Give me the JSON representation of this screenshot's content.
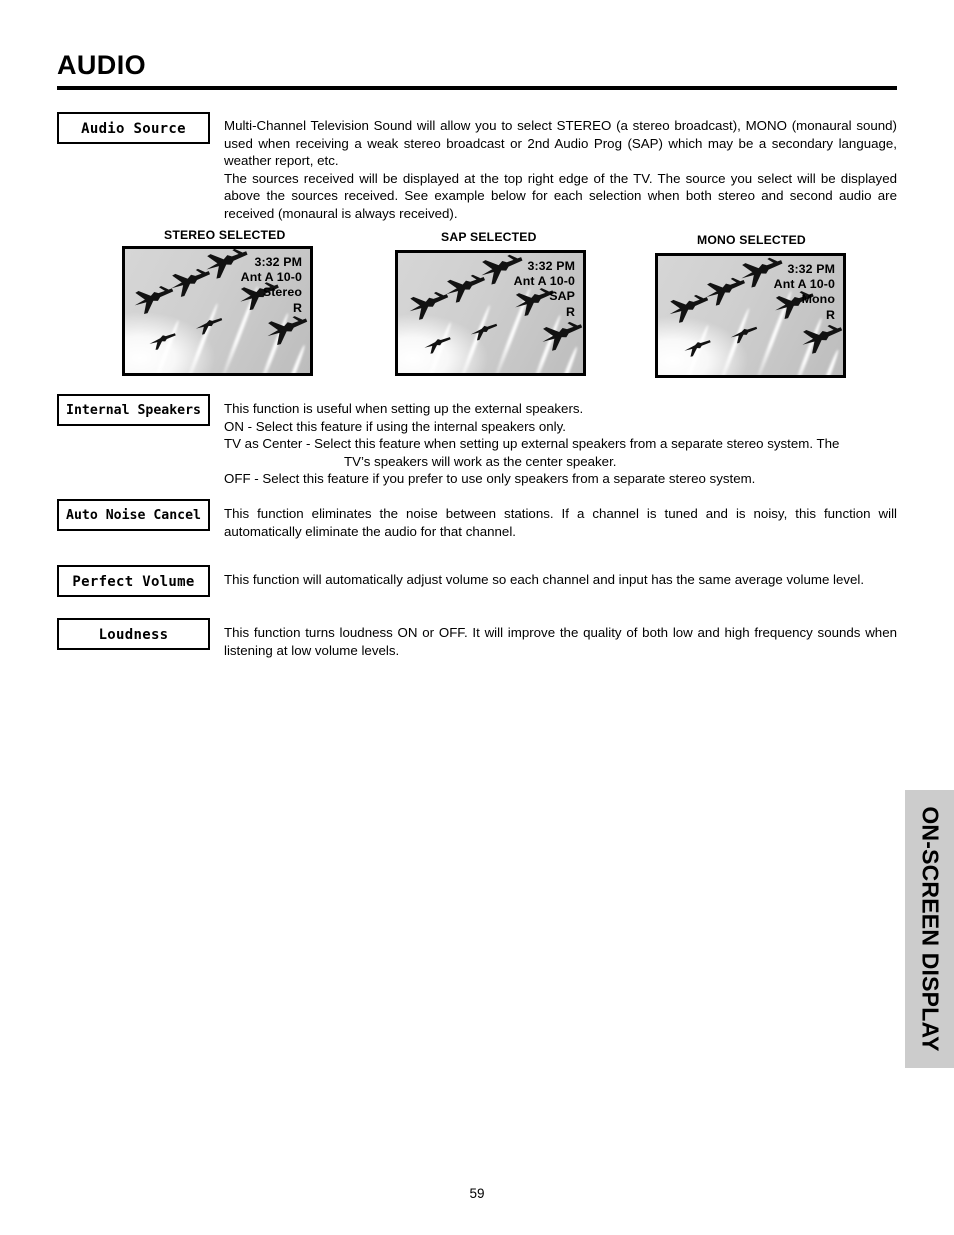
{
  "page": {
    "title": "AUDIO",
    "number": "59",
    "side_tab": "ON-SCREEN DISPLAY"
  },
  "sections": [
    {
      "label": "Audio Source",
      "paragraphs": [
        "Multi-Channel Television Sound will allow you to select STEREO (a stereo broadcast), MONO (monaural sound) used when receiving a weak stereo broadcast or 2nd Audio Prog (SAP) which may be a secondary language, weather report, etc.",
        "The sources received will be displayed at the top right edge of the TV.  The source you select will be displayed above the sources received.  See example below for each selection when both stereo and second audio are received (monaural is always received)."
      ]
    },
    {
      "label": "Internal Speakers",
      "lines": [
        "This function is useful when setting up the external speakers.",
        "ON - Select this feature if using the internal speakers only.",
        "TV as Center - Select this feature when setting up external speakers from a separate stereo system.  The",
        "TV’s speakers will work as the center speaker.",
        "OFF - Select this feature if you prefer to use only speakers from a separate stereo system."
      ]
    },
    {
      "label": "Auto Noise Cancel",
      "paragraphs": [
        "This function eliminates the noise between stations. If a channel is tuned and is noisy, this function will automatically eliminate the audio for that channel."
      ]
    },
    {
      "label": "Perfect Volume",
      "paragraphs": [
        "This function will automatically adjust volume so each channel  and input has the same average volume level."
      ]
    },
    {
      "label": "Loudness",
      "paragraphs": [
        "This function turns loudness ON or OFF.  It will improve the quality of both low and high frequency sounds when listening at low volume levels."
      ]
    }
  ],
  "examples": [
    {
      "caption": "STEREO SELECTED",
      "osd": {
        "time": "3:32 PM",
        "channel": "Ant A 10-0",
        "mode": "Stereo",
        "audio": "R"
      }
    },
    {
      "caption": "SAP SELECTED",
      "osd": {
        "time": "3:32 PM",
        "channel": "Ant A 10-0",
        "mode": "SAP",
        "audio": "R"
      }
    },
    {
      "caption": "MONO SELECTED",
      "osd": {
        "time": "3:32 PM",
        "channel": "Ant A 10-0",
        "mode": "Mono",
        "audio": "R"
      }
    }
  ],
  "colors": {
    "tab_background": "#cccccc",
    "rule": "#000000",
    "sky": "#c9c9c9"
  }
}
